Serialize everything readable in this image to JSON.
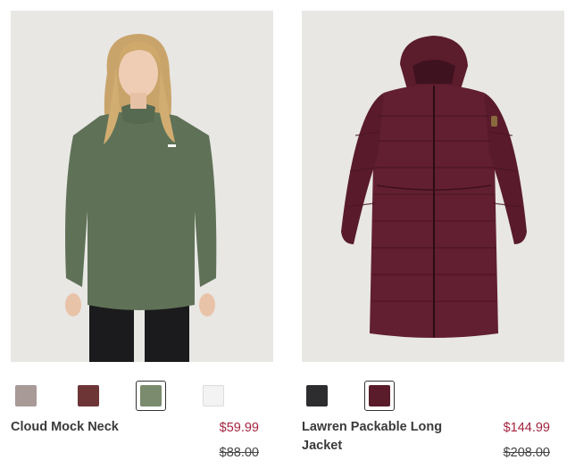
{
  "products": [
    {
      "name": "Cloud Mock Neck",
      "sale_price": "$59.99",
      "original_price": "$88.00",
      "image_icon": "model-green-sweatshirt-image",
      "swatches": [
        {
          "color": "#a89a97",
          "name": "taupe",
          "selected": false
        },
        {
          "color": "#6e3537",
          "name": "burgundy",
          "selected": false
        },
        {
          "color": "#7a8b6e",
          "name": "sage-green",
          "selected": true
        },
        {
          "color": "#f3f3f3",
          "name": "white",
          "selected": false
        }
      ]
    },
    {
      "name": "Lawren Packable Long Jacket",
      "sale_price": "$144.99",
      "original_price": "$208.00",
      "image_icon": "burgundy-long-puffer-image",
      "swatches": [
        {
          "color": "#2d2d30",
          "name": "black",
          "selected": false
        },
        {
          "color": "#5a1c2a",
          "name": "burgundy",
          "selected": true
        }
      ]
    }
  ],
  "colors": {
    "sale": "#a3233d",
    "text": "#3a3a3a",
    "photo_bg": "#e9e8e6"
  }
}
